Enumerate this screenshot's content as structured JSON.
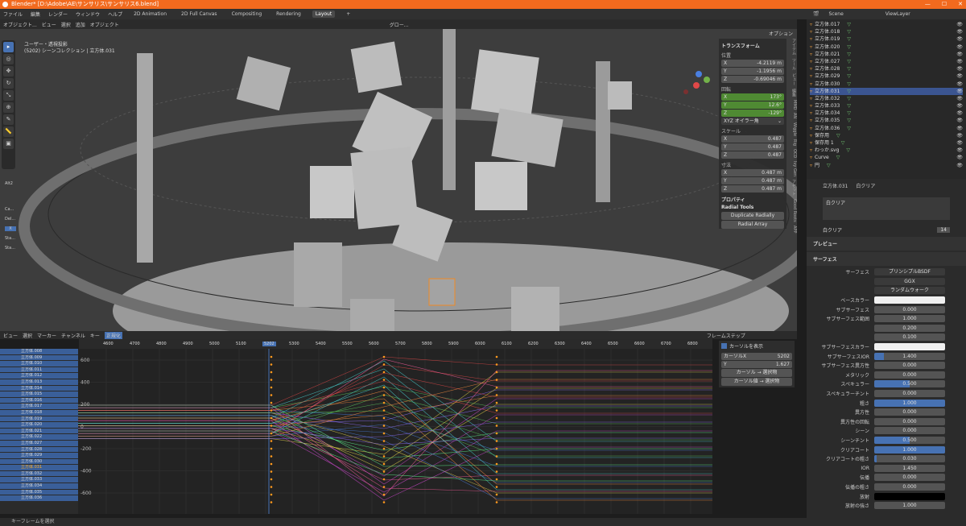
{
  "title": "Blender* [D:\\Adobe\\AE\\サンサリス\\サンサリス6.blend]",
  "menu": [
    "ファイル",
    "編集",
    "レンダー",
    "ウィンドウ",
    "ヘルプ"
  ],
  "workspaces": [
    "2D Animation",
    "2D Full Canvas",
    "Compositing",
    "Rendering",
    "Layout",
    "+"
  ],
  "viewport": {
    "header": [
      "オブジェクト...",
      "ビュー",
      "選択",
      "追加",
      "オブジェクト"
    ],
    "mode_info": "ユーザー・透視投影",
    "collection_info": "(5202) シーンコレクション | 立方体.031",
    "shading": "グロー...",
    "options": "オプション"
  },
  "transform": {
    "title": "トランスフォーム",
    "loc_label": "位置",
    "loc": [
      [
        "X",
        "-4.2119 m"
      ],
      [
        "Y",
        "-1.1956 m"
      ],
      [
        "Z",
        "-0.69046 m"
      ]
    ],
    "rot_label": "回転",
    "rot": [
      [
        "X",
        "173°"
      ],
      [
        "Y",
        "12.6°"
      ],
      [
        "Z",
        "-129°"
      ]
    ],
    "rot_mode": "XYZ オイラー角",
    "scale_label": "スケール",
    "scale": [
      [
        "X",
        "0.487"
      ],
      [
        "Y",
        "0.487"
      ],
      [
        "Z",
        "0.487"
      ]
    ],
    "dim_label": "寸法",
    "dim": [
      [
        "X",
        "0.487 m"
      ],
      [
        "Y",
        "0.487 m"
      ],
      [
        "Z",
        "0.487 m"
      ]
    ],
    "properties": "プロパティ",
    "radial_title": "Radial Tools",
    "dup_btn": "Duplicate Radially",
    "array_btn": "Radial Array"
  },
  "vtabs": [
    "アイテム",
    "ツール",
    "ビュー",
    "編集",
    "MMD",
    "AN",
    "Wiggle",
    "Rig",
    "OCD",
    "Ivy Gen",
    "アセット",
    "Good Roots",
    "APP"
  ],
  "leftside": {
    "header": "Alt2",
    "labels": [
      "Ca...",
      "Del...",
      "X",
      "Sta...",
      "Sta...",
      "M"
    ]
  },
  "timeline": {
    "header": [
      "ビュー",
      "選択",
      "マーカー",
      "チャンネル",
      "キー",
      "正規化"
    ],
    "snap": "フレームステップ",
    "ruler": [
      "4600",
      "4700",
      "4800",
      "4900",
      "5000",
      "5100",
      "5202",
      "5300",
      "5400",
      "5500",
      "5600",
      "5700",
      "5800",
      "5900",
      "6000",
      "6100",
      "6200",
      "6300",
      "6400",
      "6500",
      "6600",
      "6700",
      "6800"
    ],
    "yticks": [
      "600",
      "400",
      "200",
      "0",
      "-200",
      "-400",
      "-600"
    ],
    "cursor_panel": {
      "show": "カーソルを表示",
      "cursorx_label": "カーソルX",
      "cursorx": "5202",
      "y_label": "Y",
      "y": "1.627",
      "btn1": "カーソル → 選択物",
      "btn2": "カーソル値 → 選択物"
    }
  },
  "channels": [
    "立方体.008",
    "立方体.009",
    "立方体.010",
    "立方体.011",
    "立方体.012",
    "立方体.013",
    "立方体.014",
    "立方体.015",
    "立方体.016",
    "立方体.017",
    "立方体.018",
    "立方体.019",
    "立方体.020",
    "立方体.021",
    "立方体.022",
    "立方体.027",
    "立方体.028",
    "立方体.029",
    "立方体.030",
    "立方体.031",
    "立方体.032",
    "立方体.033",
    "立方体.034",
    "立方体.035",
    "立方体.036"
  ],
  "outliner": {
    "scene": "Scene",
    "viewlayer": "ViewLayer",
    "items": [
      "立方体.017",
      "立方体.018",
      "立方体.019",
      "立方体.020",
      "立方体.021",
      "立方体.027",
      "立方体.028",
      "立方体.029",
      "立方体.030",
      "立方体.031",
      "立方体.032",
      "立方体.033",
      "立方体.034",
      "立方体.035",
      "立方体.036",
      "保存用",
      "保存用 1",
      "わっか.svg",
      "Curve",
      "円"
    ]
  },
  "props": {
    "object": "立方体.031",
    "material": "白クリア",
    "slot": "白クリア",
    "mat_users": "14",
    "preview": "プレビュー",
    "surface": "サーフェス",
    "surface_label": "サーフェス",
    "surface_val": "プリンシプルBSDF",
    "dist": "GGX",
    "ss": "ランダムウォーク",
    "rows": [
      [
        "ベースカラー",
        "",
        0
      ],
      [
        "サブサーフェス",
        "0.000",
        0
      ],
      [
        "サブサーフェス範囲",
        "1.000",
        0
      ],
      [
        "",
        "0.200",
        0
      ],
      [
        "",
        "0.100",
        0
      ],
      [
        "サブサーフェスカラー",
        "",
        0
      ],
      [
        "サブサーフェスIOR",
        "1.400",
        0.14
      ],
      [
        "サブサーフェス異方性",
        "0.000",
        0
      ],
      [
        "メタリック",
        "0.000",
        0
      ],
      [
        "スペキュラー",
        "0.500",
        0.5
      ],
      [
        "スペキュラーチント",
        "0.000",
        0
      ],
      [
        "粗さ",
        "1.000",
        1
      ],
      [
        "異方性",
        "0.000",
        0
      ],
      [
        "異方性の回転",
        "0.000",
        0
      ],
      [
        "シーン",
        "0.000",
        0
      ],
      [
        "シーンチント",
        "0.500",
        0.5
      ],
      [
        "クリアコート",
        "1.000",
        1
      ],
      [
        "クリアコートの粗さ",
        "0.030",
        0.03
      ],
      [
        "IOR",
        "1.450",
        0
      ],
      [
        "伝播",
        "0.000",
        0
      ],
      [
        "伝播の粗さ",
        "0.000",
        0
      ],
      [
        "放射",
        "",
        0
      ],
      [
        "放射の強さ",
        "1.000",
        0
      ]
    ]
  },
  "status": "キーフレームを選択"
}
